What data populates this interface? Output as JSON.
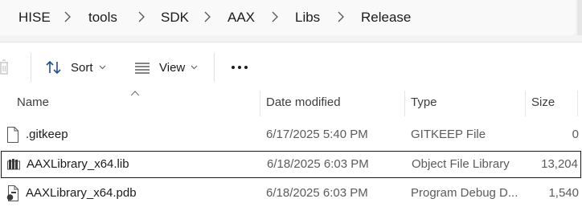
{
  "breadcrumb": [
    "HISE",
    "tools",
    "SDK",
    "AAX",
    "Libs",
    "Release"
  ],
  "toolbar": {
    "sort_label": "Sort",
    "view_label": "View"
  },
  "columns": {
    "name": "Name",
    "date": "Date modified",
    "type": "Type",
    "size": "Size"
  },
  "files": [
    {
      "name": ".gitkeep",
      "date": "6/17/2025 5:40 PM",
      "type": "GITKEEP File",
      "size": "0",
      "icon": "blank-file-icon"
    },
    {
      "name": "AAXLibrary_x64.lib",
      "date": "6/18/2025 6:03 PM",
      "type": "Object File Library",
      "size": "13,204",
      "icon": "library-file-icon",
      "selected": true
    },
    {
      "name": "AAXLibrary_x64.pdb",
      "date": "6/18/2025 6:03 PM",
      "type": "Program Debug D...",
      "size": "1,540",
      "icon": "debug-file-icon"
    }
  ]
}
